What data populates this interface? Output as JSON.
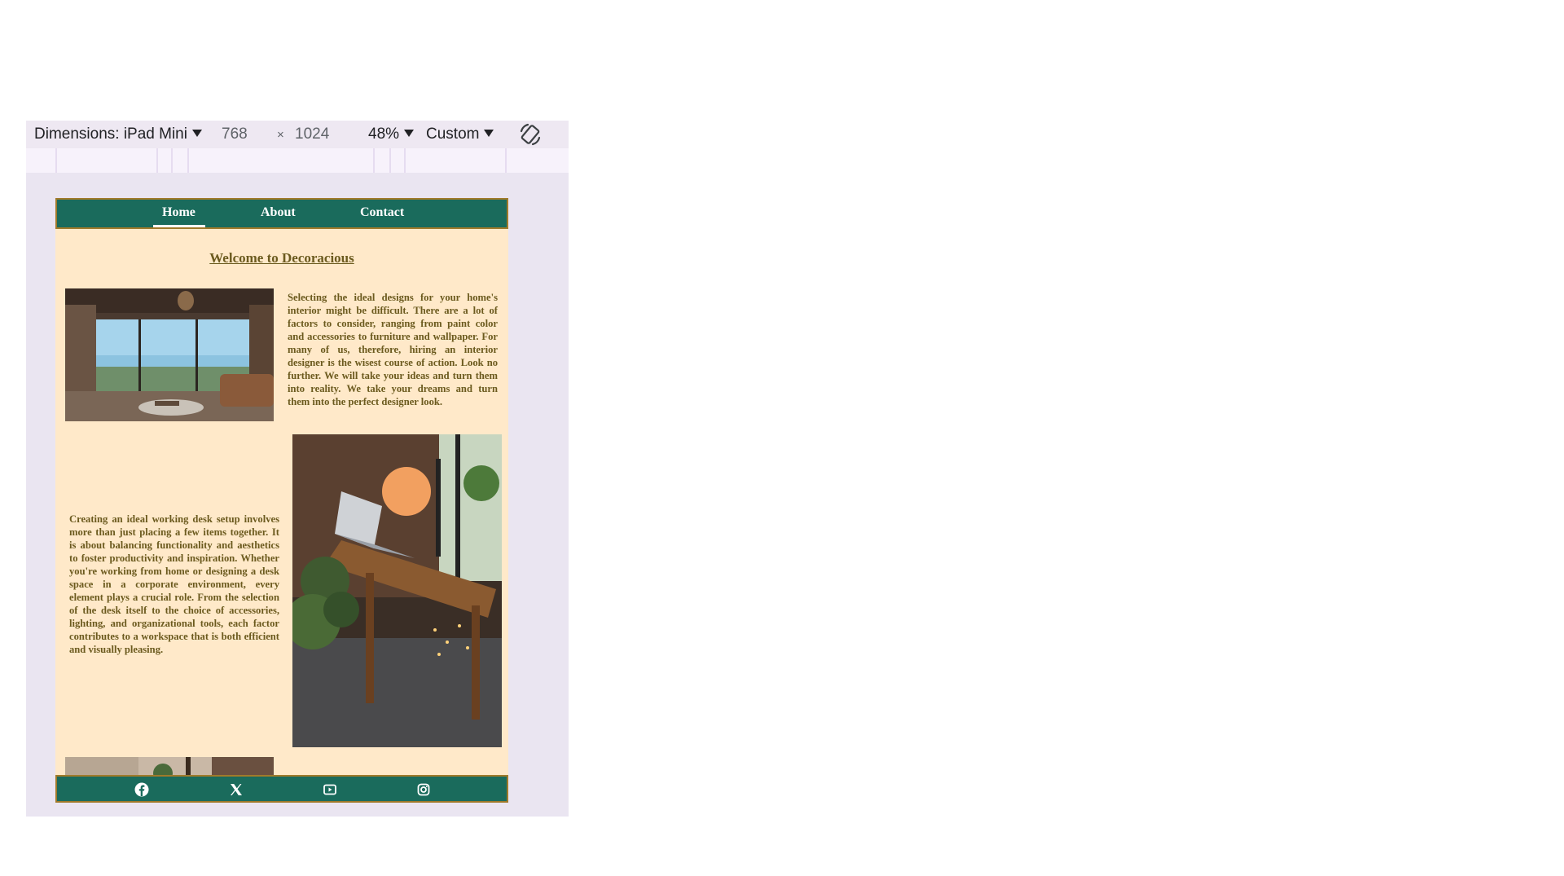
{
  "devtools": {
    "dimensions_label": "Dimensions: iPad Mini",
    "width": "768",
    "times": "×",
    "height": "1024",
    "zoom": "48%",
    "throttle": "Custom"
  },
  "site": {
    "nav": {
      "items": [
        {
          "label": "Home",
          "active": true
        },
        {
          "label": "About",
          "active": false
        },
        {
          "label": "Contact",
          "active": false
        }
      ]
    },
    "title": "Welcome to Decoracious",
    "paragraph1": "Selecting the ideal designs for your home's interior might be difficult. There are a lot of factors to consider, ranging from paint color and accessories to furniture and wallpaper. For many of us, therefore, hiring an interior designer is the wisest course of action. Look no further. We will take your ideas and turn them into reality. We take your dreams and turn them into the perfect designer look.",
    "paragraph2": "Creating an ideal working desk setup involves more than just placing a few items together. It is about balancing functionality and aesthetics to foster productivity and inspiration. Whether you're working from home or designing a desk space in a corporate environment, every element plays a crucial role. From the selection of the desk itself to the choice of accessories, lighting, and organizational tools, each factor contributes to a workspace that is both efficient and visually pleasing.",
    "footer_icons": [
      "facebook-icon",
      "x-twitter-icon",
      "youtube-icon",
      "instagram-icon"
    ]
  },
  "colors": {
    "nav_bg": "#1a6b5c",
    "page_bg": "#ffe9c9",
    "text": "#6b5a1e",
    "border": "#a07a2a"
  }
}
